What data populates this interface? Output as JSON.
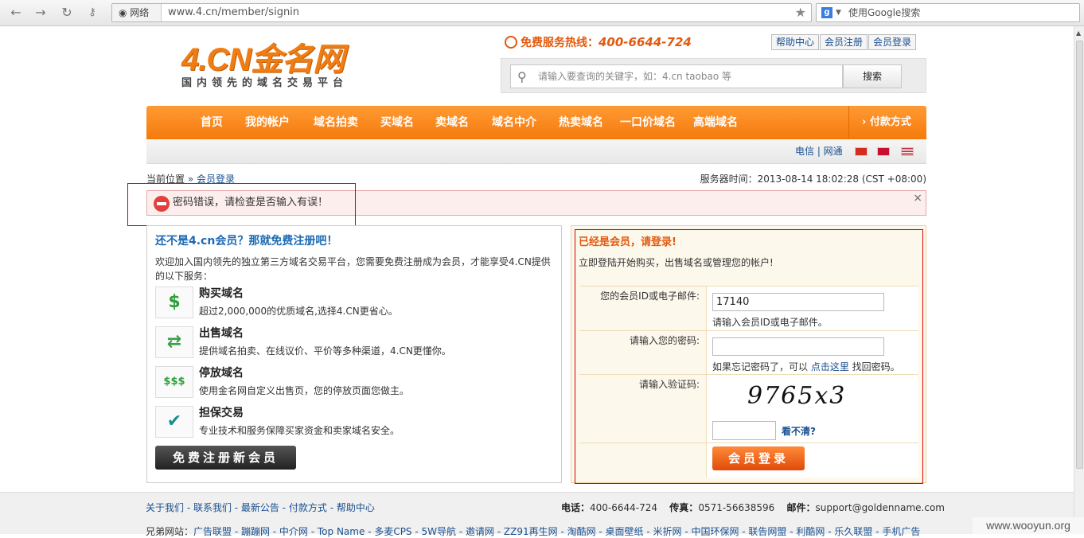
{
  "browser": {
    "security_chip": "网络",
    "url": "www.4.cn/member/signin",
    "search_placeholder": "使用Google搜索",
    "back_icon": "back-arrow-icon",
    "forward_icon": "forward-arrow-icon",
    "reload_icon": "reload-icon",
    "key_icon": "key-icon"
  },
  "header": {
    "logo_main": "4.CN金名网",
    "logo_sub": "国内领先的域名交易平台",
    "hotline_label": "免费服务热线：",
    "hotline_number": "400-6644-724",
    "links": [
      "帮助中心",
      "会员注册",
      "会员登录"
    ],
    "search_placeholder": "请输入要查询的关键字，如：4.cn taobao 等",
    "search_button": "搜索"
  },
  "nav": {
    "items": [
      "首页",
      "我的帐户",
      "域名拍卖",
      "买域名",
      "卖域名",
      "域名中介",
      "热卖域名",
      "一口价域名",
      "高端域名"
    ],
    "payment": "付款方式"
  },
  "subbar": {
    "networks": "电信 | 网通"
  },
  "breadcrumb": {
    "label": "当前位置",
    "current": "会员登录"
  },
  "server_time": "服务器时间：2013-08-14 18:02:28 (CST +08:00)",
  "error": {
    "message": "密码错误，请检查是否输入有误！",
    "close": "×"
  },
  "register_panel": {
    "title": "还不是4.cn会员？那就免费注册吧！",
    "intro": "欢迎加入国内领先的独立第三方域名交易平台，您需要免费注册成为会员，才能享受4.CN提供的以下服务：",
    "services": [
      {
        "name": "购买域名",
        "desc": "超过2,000,000的优质域名,选择4.CN更省心。",
        "icon": "$"
      },
      {
        "name": "出售域名",
        "desc": "提供域名拍卖、在线议价、平价等多种渠道，4.CN更懂你。",
        "icon": "⇄"
      },
      {
        "name": "停放域名",
        "desc": "使用金名网自定义出售页，您的停放页面您做主。",
        "icon": "$$$"
      },
      {
        "name": "担保交易",
        "desc": "专业技术和服务保障买家资金和卖家域名安全。",
        "icon": "✔"
      }
    ],
    "button": "免费注册新会员"
  },
  "login_panel": {
    "title": "已经是会员，请登录!",
    "intro": "立即登陆开始购买，出售域名或管理您的帐户!",
    "id_label": "您的会员ID或电子邮件:",
    "id_value": "17140",
    "id_hint": "请输入会员ID或电子邮件。",
    "pwd_label": "请输入您的密码:",
    "pwd_hint_prefix": "如果忘记密码了，可以 ",
    "pwd_hint_link": "点击这里",
    "pwd_hint_suffix": " 找回密码。",
    "captcha_label": "请输入验证码:",
    "captcha_text": "9765x3",
    "captcha_refresh": "看不清?",
    "login_button": "会员登录"
  },
  "footer": {
    "links": "关于我们 - 联系我们 - 最新公告 - 付款方式 - 帮助中心",
    "phone_label": "电话：",
    "phone": "400-6644-724",
    "fax_label": "传真：",
    "fax": "0571-56638596",
    "email_label": "邮件：",
    "email": "support@goldenname.com",
    "friends_label": "兄弟网站：",
    "friends": "广告联盟 - 蹦蹦网 - 中介网 - Top Name - 多麦CPS - 5W导航 - 邀请网 - ZZ91再生网 - 淘酷网 - 桌面壁纸 - 米折网 - 中国环保网 - 联告网盟 - 利酷网 - 乐久联盟 - 手机广告"
  },
  "watermark": "www.wooyun.org"
}
